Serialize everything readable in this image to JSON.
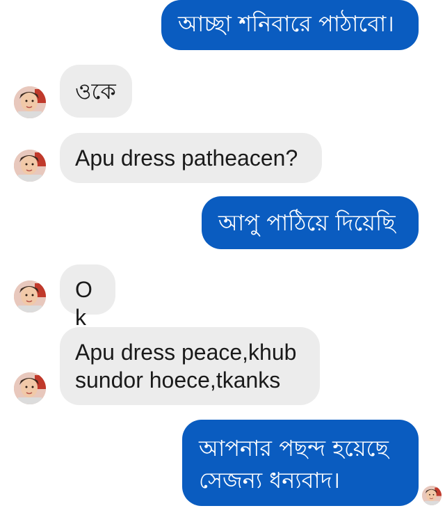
{
  "messages": [
    {
      "sender": "me",
      "text": "আচ্ছা শনিবারে পাঠাবো।"
    },
    {
      "sender": "them",
      "text": "ওকে"
    },
    {
      "sender": "them",
      "text": "Apu dress patheacen?"
    },
    {
      "sender": "me",
      "text": "আপু পাঠিয়ে দিয়েছি"
    },
    {
      "sender": "them",
      "text": "Ok"
    },
    {
      "sender": "them",
      "text": "Apu dress peace,khub\nsundor hoece,tkanks"
    },
    {
      "sender": "me",
      "text": "আপনার পছন্দ হয়েছে\nসেজন্য ধন্যবাদ।"
    }
  ],
  "colors": {
    "outgoing_bubble": "#0a5cc0",
    "incoming_bubble": "#ececec",
    "outgoing_text": "#ffffff",
    "incoming_text": "#1a1a1a"
  },
  "icons": {
    "contact_avatar": "child-photo-avatar"
  }
}
